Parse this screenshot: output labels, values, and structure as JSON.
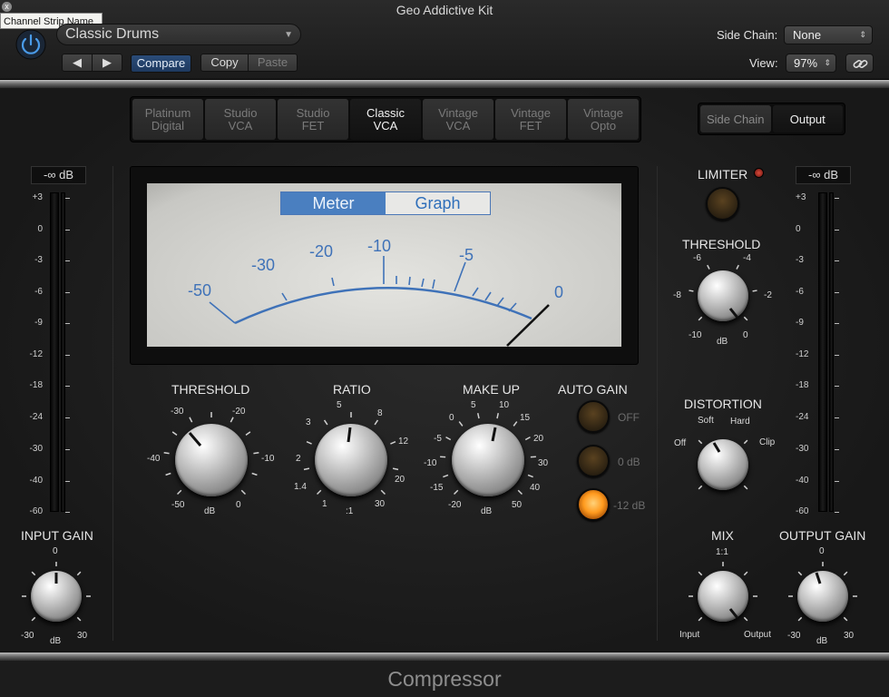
{
  "window": {
    "title": "Geo Addictive Kit",
    "tooltip": "Channel Strip Name",
    "tooltip_close": "x"
  },
  "header": {
    "preset": "Classic Drums",
    "prev": "◀",
    "next": "▶",
    "compare": "Compare",
    "copy": "Copy",
    "paste": "Paste",
    "side_chain_label": "Side Chain:",
    "side_chain_value": "None",
    "view_label": "View:",
    "view_value": "97%",
    "select_arrow": "⇕",
    "preset_arrow": "▼"
  },
  "models": [
    "Platinum\nDigital",
    "Studio\nVCA",
    "Studio\nFET",
    "Classic\nVCA",
    "Vintage\nVCA",
    "Vintage\nFET",
    "Vintage\nOpto"
  ],
  "active_model": "Classic\nVCA",
  "output_tabs": {
    "side_chain": "Side Chain",
    "output": "Output"
  },
  "meter": {
    "input_db": "-∞ dB",
    "output_db": "-∞ dB",
    "scale": [
      "+3",
      "0",
      "-3",
      "-6",
      "-9",
      "-12",
      "-18",
      "-24",
      "-30",
      "-40",
      "-60"
    ]
  },
  "vu": {
    "tabs": {
      "meter": "Meter",
      "graph": "Graph"
    },
    "scale_labels": [
      "-50",
      "-30",
      "-20",
      "-10",
      "-5",
      "0"
    ]
  },
  "controls": {
    "threshold": {
      "label": "THRESHOLD",
      "ticks": [
        "-30",
        "-20",
        "-40",
        "-10",
        "-50",
        "0"
      ],
      "unit": "dB"
    },
    "ratio": {
      "label": "RATIO",
      "ticks": [
        "5",
        "3",
        "8",
        "2",
        "12",
        "1.4",
        "20",
        "1",
        "30"
      ],
      "unit": ":1"
    },
    "makeup": {
      "label": "MAKE UP",
      "ticks": [
        "5",
        "10",
        "0",
        "15",
        "-5",
        "20",
        "-10",
        "30",
        "-15",
        "40",
        "-20",
        "50"
      ],
      "unit": "dB"
    },
    "auto_gain": {
      "label": "AUTO GAIN",
      "options": [
        "OFF",
        "0 dB",
        "-12 dB"
      ],
      "selected": "-12 dB"
    },
    "limiter": {
      "label": "LIMITER",
      "threshold_label": "THRESHOLD",
      "ticks": [
        "-6",
        "-4",
        "-8",
        "-2",
        "-10",
        "0"
      ],
      "unit": "dB"
    },
    "distortion": {
      "label": "DISTORTION",
      "ticks": [
        "Soft",
        "Hard",
        "Off",
        "Clip"
      ]
    },
    "mix": {
      "label": "MIX",
      "top": "1:1",
      "left": "Input",
      "right": "Output"
    },
    "input_gain": {
      "label": "INPUT GAIN",
      "top": "0",
      "left": "-30",
      "right": "30",
      "unit": "dB"
    },
    "output_gain": {
      "label": "OUTPUT GAIN",
      "top": "0",
      "left": "-30",
      "right": "30",
      "unit": "dB"
    }
  },
  "footer": "Compressor"
}
